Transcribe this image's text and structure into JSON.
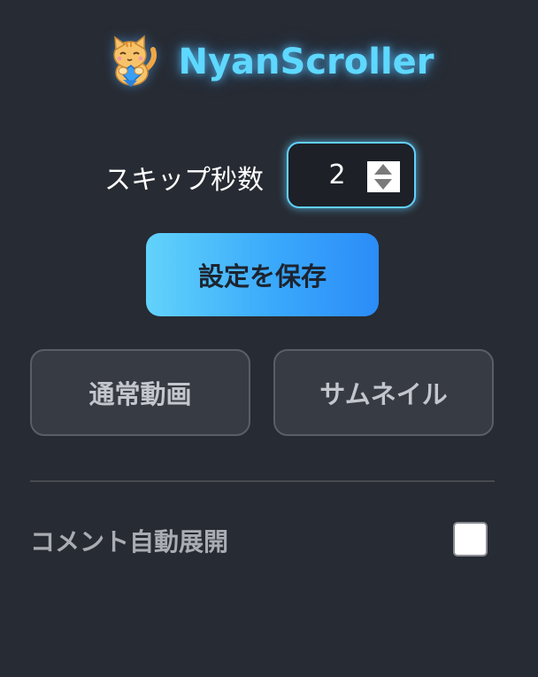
{
  "app": {
    "title": "NyanScroller",
    "logo_icon": "cat-logo-icon"
  },
  "skip": {
    "label": "スキップ秒数",
    "value": "2"
  },
  "actions": {
    "save_label": "設定を保存"
  },
  "modes": {
    "normal_label": "通常動画",
    "thumbnail_label": "サムネイル"
  },
  "comments": {
    "label": "コメント自動展開",
    "checked": false
  },
  "colors": {
    "background": "#272b33",
    "accent": "#5ed8ff",
    "save_gradient_start": "#62d3fb",
    "save_gradient_end": "#2b8cf8",
    "mode_button_bg": "#373b44"
  }
}
